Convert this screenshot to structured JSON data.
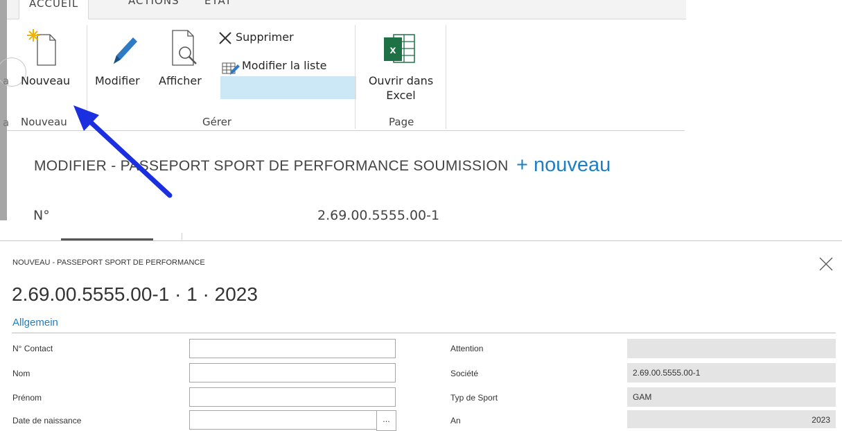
{
  "ribbon": {
    "tabs": [
      "ACCUEIL",
      "ACTIONS",
      "ÉTAT"
    ],
    "cut_left_label": "a",
    "cut_left_label2": "a",
    "buttons": {
      "nouveau": "Nouveau",
      "modifier": "Modifier",
      "afficher": "Afficher",
      "supprimer": "Supprimer",
      "modifier_liste": "Modifier la liste",
      "excel_line1": "Ouvrir dans",
      "excel_line2": "Excel"
    },
    "groups": [
      "Nouveau",
      "Gérer",
      "Page"
    ]
  },
  "page": {
    "heading": "MODIFIER - PASSEPORT SPORT DE PERFORMANCE SOUMISSION",
    "new_link": "+ nouveau",
    "no_label": "N°",
    "no_value": "2.69.00.5555.00-1"
  },
  "dialog": {
    "subtitle": "NOUVEAU - PASSEPORT SPORT DE PERFORMANCE",
    "title": "2.69.00.5555.00-1 · 1 · 2023",
    "section": "Allgemein",
    "left_fields": [
      {
        "label": "N° Contact",
        "value": ""
      },
      {
        "label": "Nom",
        "value": ""
      },
      {
        "label": "Prénom",
        "value": ""
      },
      {
        "label": "Date de naissance",
        "value": ""
      }
    ],
    "right_fields": [
      {
        "label": "Attention",
        "value": ""
      },
      {
        "label": "Société",
        "value": "2.69.00.5555.00-1"
      },
      {
        "label": "Typ de Sport",
        "value": "GAM"
      },
      {
        "label": "An",
        "value": "2023"
      }
    ],
    "lookup_button": "..."
  },
  "colors": {
    "accent": "#1f7fc2",
    "arrow": "#1a2fe0",
    "highlight": "#cce8f6",
    "excel_green": "#1e7145"
  }
}
